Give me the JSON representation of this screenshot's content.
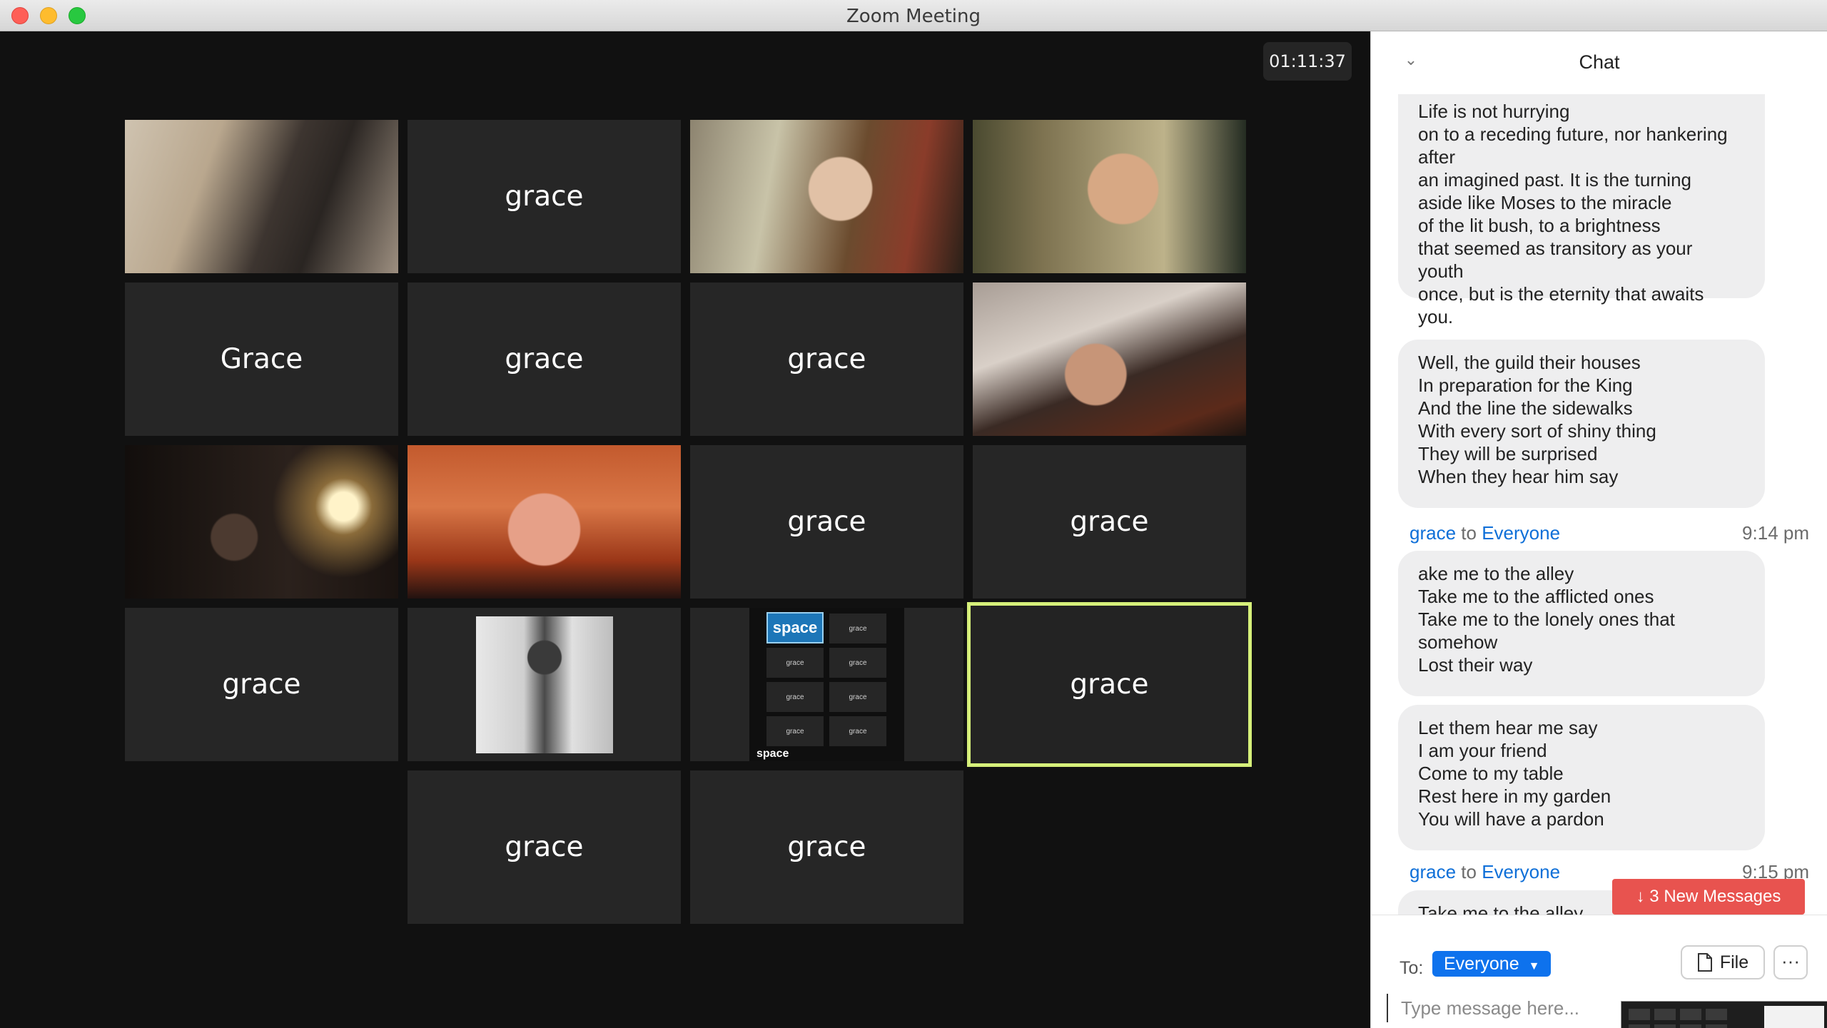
{
  "window": {
    "title": "Zoom Meeting"
  },
  "timer": "01:11:37",
  "tiles": [
    {
      "id": 1,
      "type": "video",
      "label": ""
    },
    {
      "id": 2,
      "type": "name",
      "label": "grace"
    },
    {
      "id": 3,
      "type": "video",
      "label": ""
    },
    {
      "id": 4,
      "type": "video",
      "label": ""
    },
    {
      "id": 5,
      "type": "name",
      "label": "Grace"
    },
    {
      "id": 6,
      "type": "name",
      "label": "grace"
    },
    {
      "id": 7,
      "type": "name",
      "label": "grace"
    },
    {
      "id": 8,
      "type": "video",
      "label": ""
    },
    {
      "id": 9,
      "type": "video",
      "label": ""
    },
    {
      "id": 10,
      "type": "video",
      "label": ""
    },
    {
      "id": 11,
      "type": "name",
      "label": "grace"
    },
    {
      "id": 12,
      "type": "name",
      "label": "grace"
    },
    {
      "id": 13,
      "type": "name",
      "label": "grace"
    },
    {
      "id": 14,
      "type": "photo",
      "label": ""
    },
    {
      "id": 15,
      "type": "share",
      "label": ""
    },
    {
      "id": 16,
      "type": "name",
      "label": "grace",
      "active": true
    },
    {
      "id": 17,
      "type": "name",
      "label": "grace"
    },
    {
      "id": 18,
      "type": "name",
      "label": "grace"
    }
  ],
  "share_thumb": {
    "logo": "space",
    "cells": [
      "grace",
      "grace",
      "grace",
      "grace",
      "grace",
      "grace",
      "grace"
    ],
    "footer": "space"
  },
  "chat": {
    "title": "Chat",
    "messages": [
      {
        "text": "Life is not hurrying\non to a receding future, nor hankering\nafter\nan imagined past. It is the turning\naside like Moses to the miracle\nof the lit bush, to a brightness\nthat seemed as transitory as your\nyouth\nonce, but is the eternity that awaits\nyou."
      },
      {
        "text": "Well, the guild their houses\nIn preparation for the King\nAnd the line the sidewalks\nWith every sort of shiny thing\nThey will be surprised\nWhen they hear him say"
      },
      {
        "sender": "grace",
        "to_word": "to",
        "recipient": "Everyone",
        "time": "9:14 pm"
      },
      {
        "text": "ake me to the alley\nTake me to the afflicted ones\nTake me to the lonely ones that\nsomehow\nLost their way"
      },
      {
        "text": "Let them hear me say\nI am your friend\nCome to my table\nRest here in my garden\nYou will have a pardon"
      },
      {
        "sender": "grace",
        "to_word": "to",
        "recipient": "Everyone",
        "time": "9:15 pm"
      },
      {
        "text": "Take me to the alley"
      }
    ],
    "new_messages_label": "3 New Messages",
    "to_label": "To:",
    "recipient": "Everyone",
    "file_label": "File",
    "more_label": "···",
    "input_placeholder": "Type message here..."
  }
}
